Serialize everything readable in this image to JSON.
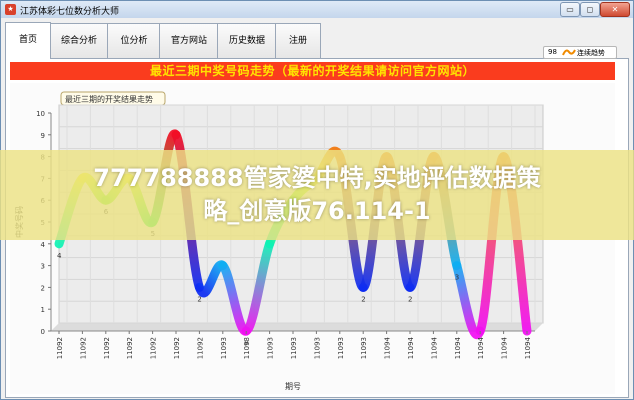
{
  "window": {
    "title": "江苏体彩七位数分析大师",
    "app_icon": "app-logo-icon",
    "controls": {
      "minimize": "▭",
      "restore": "◻",
      "close": "✕"
    }
  },
  "tabs": [
    {
      "label": "首页",
      "active": true
    },
    {
      "label": "综合分析",
      "active": false
    },
    {
      "label": "位分析",
      "active": false
    },
    {
      "label": "官方网站",
      "active": false
    },
    {
      "label": "历史数据",
      "active": false
    },
    {
      "label": "注册",
      "active": false
    }
  ],
  "banner": {
    "text": "最近三期中奖号码走势（最新的开奖结果请访问官方网站）"
  },
  "overlay": {
    "line1": "777788888管家婆中特,实地评估数据策",
    "line2": "略_创意版76.114-1"
  },
  "colors": {
    "banner_bg": "#fa3c1e",
    "banner_text": "#ffe300",
    "overlay": "#ece284"
  },
  "chart_data": {
    "type": "line",
    "title": "最近三期的开奖结果走势",
    "ylabel": "中奖号码",
    "xlabel": "期号",
    "ylim": [
      0,
      10
    ],
    "yticks": [
      0,
      1,
      2,
      3,
      4,
      5,
      6,
      7,
      8,
      9,
      10
    ],
    "grid": true,
    "legend": {
      "position": "top-right",
      "value": "98",
      "name": "连续趋势"
    },
    "x": [
      "11092",
      "11092",
      "11092",
      "11092",
      "11092",
      "11092",
      "11092",
      "11093",
      "11093",
      "11093",
      "11093",
      "11093",
      "11093",
      "11093",
      "11094",
      "11094",
      "11094",
      "11094",
      "11094",
      "11094",
      "11094"
    ],
    "series": [
      {
        "name": "连续趋势",
        "values": [
          4,
          7,
          6,
          7,
          5,
          9,
          2,
          3,
          0,
          4,
          6,
          7,
          8,
          2,
          8,
          2,
          8,
          3,
          0,
          8,
          0
        ],
        "labels": [
          "4",
          "",
          "6",
          "",
          "5",
          "",
          "2",
          "",
          "0",
          "",
          "",
          "",
          "",
          "2",
          "",
          "2",
          "",
          "3",
          "",
          "",
          ""
        ]
      }
    ]
  }
}
